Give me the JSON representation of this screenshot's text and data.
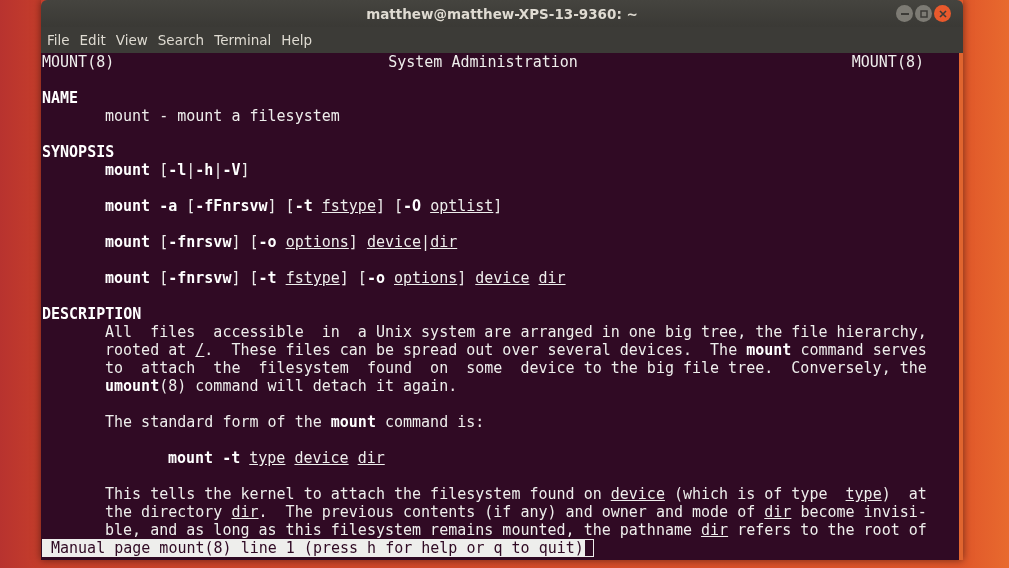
{
  "window": {
    "title": "matthew@matthew-XPS-13-9360: ~"
  },
  "menu": [
    "File",
    "Edit",
    "View",
    "Search",
    "Terminal",
    "Help"
  ],
  "man_page": {
    "header": {
      "left": "MOUNT(8)",
      "center": "System Administration",
      "right": "MOUNT(8)"
    },
    "lines": [
      {
        "kind": "blank"
      },
      {
        "kind": "heading",
        "text": "NAME"
      },
      {
        "kind": "body",
        "text": "mount - mount a filesystem"
      },
      {
        "kind": "blank"
      },
      {
        "kind": "heading",
        "text": "SYNOPSIS"
      },
      {
        "kind": "body",
        "text": "**mount** [**-l**|**-h**|**-V**]"
      },
      {
        "kind": "blank"
      },
      {
        "kind": "body",
        "text": "**mount -a** [**-fFnrsvw**] [**-t** *fstype*] [**-O** *optlist*]"
      },
      {
        "kind": "blank"
      },
      {
        "kind": "body",
        "text": "**mount** [**-fnrsvw**] [**-o** *options*] *device*|*dir*"
      },
      {
        "kind": "blank"
      },
      {
        "kind": "body",
        "text": "**mount** [**-fnrsvw**] [**-t** *fstype*] [**-o** *options*] *device* *dir*"
      },
      {
        "kind": "blank"
      },
      {
        "kind": "heading",
        "text": "DESCRIPTION"
      },
      {
        "kind": "body",
        "text": "All  files  accessible  in  a Unix system are arranged in one big tree, the file hierarchy,"
      },
      {
        "kind": "body",
        "text": "rooted at */*.  These files can be spread out over several devices.  The **mount** command serves"
      },
      {
        "kind": "body",
        "text": "to  attach  the  filesystem  found  on  some  device to the big file tree.  Conversely, the"
      },
      {
        "kind": "body",
        "text": "**umount**(8) command will detach it again."
      },
      {
        "kind": "blank"
      },
      {
        "kind": "body",
        "text": "The standard form of the **mount** command is:"
      },
      {
        "kind": "blank"
      },
      {
        "kind": "example",
        "text": "**mount -t** *type* *device* *dir*"
      },
      {
        "kind": "blank"
      },
      {
        "kind": "body",
        "text": "This tells the kernel to attach the filesystem found on *device* (which is of type  *type*)  at"
      },
      {
        "kind": "body",
        "text": "the directory *dir*.  The previous contents (if any) and owner and mode of *dir* become invisi-"
      },
      {
        "kind": "body",
        "text": "ble, and as long as this filesystem remains mounted, the pathname *dir* refers to the root of"
      }
    ],
    "status": "Manual page mount(8) line 1 (press h for help or q to quit)"
  }
}
